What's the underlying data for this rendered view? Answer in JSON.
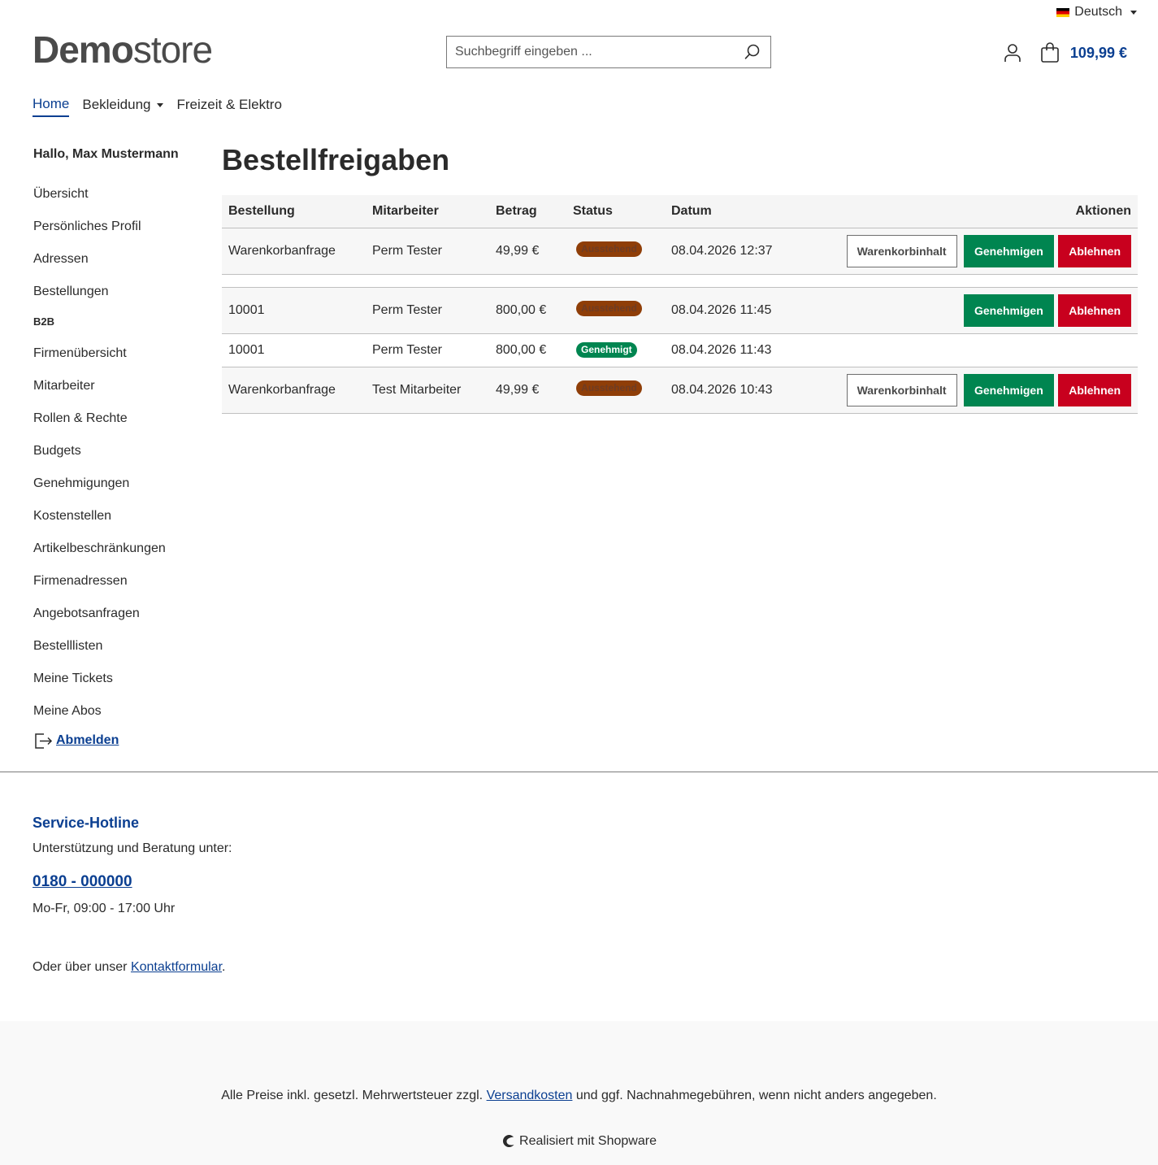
{
  "language": {
    "label": "Deutsch"
  },
  "logo": {
    "bold": "Demo",
    "light": "store"
  },
  "search": {
    "placeholder": "Suchbegriff eingeben ..."
  },
  "cart": {
    "total": "109,99 €"
  },
  "nav": {
    "items": [
      {
        "label": "Home"
      },
      {
        "label": "Bekleidung"
      },
      {
        "label": "Freizeit & Elektro"
      }
    ]
  },
  "sidebar": {
    "greeting": "Hallo, Max Mustermann",
    "links": [
      "Übersicht",
      "Persönliches Profil",
      "Adressen",
      "Bestellungen"
    ],
    "section_b2b": "B2B",
    "b2b_links": [
      "Firmenübersicht",
      "Mitarbeiter",
      "Rollen & Rechte",
      "Budgets",
      "Genehmigungen",
      "Kostenstellen",
      "Artikelbeschränkungen",
      "Firmenadressen",
      "Angebotsanfragen",
      "Bestelllisten",
      "Meine Tickets",
      "Meine Abos"
    ],
    "logout": "Abmelden"
  },
  "main": {
    "title": "Bestellfreigaben",
    "columns": [
      "Bestellung",
      "Mitarbeiter",
      "Betrag",
      "Status",
      "Datum",
      "Aktionen"
    ],
    "rows": [
      {
        "order": "Warenkorbanfrage",
        "employee": "Perm Tester",
        "amount": "49,99 €",
        "status": "Ausstehend",
        "date": "08.04.2026 12:37"
      },
      {
        "order": "10001",
        "employee": "Perm Tester",
        "amount": "800,00 €",
        "status": "Ausstehend",
        "date": "08.04.2026 11:45"
      },
      {
        "order": "10001",
        "employee": "Perm Tester",
        "amount": "800,00 €",
        "status": "Genehmigt",
        "date": "08.04.2026 11:43"
      },
      {
        "order": "Warenkorbanfrage",
        "employee": "Test Mitarbeiter",
        "amount": "49,99 €",
        "status": "Ausstehend",
        "date": "08.04.2026 10:43"
      }
    ],
    "actions": {
      "cart": "Warenkorbinhalt",
      "approve": "Genehmigen",
      "decline": "Ablehnen"
    }
  },
  "footer": {
    "hotline_title": "Service-Hotline",
    "support_text": "Unterstützung und Beratung unter:",
    "phone": "0180 - 000000",
    "hours": "Mo-Fr, 09:00 - 17:00 Uhr",
    "contact_prefix": "Oder über unser ",
    "contact_link": "Kontaktformular",
    "contact_suffix": ".",
    "vat_prefix": "Alle Preise inkl. gesetzl. Mehrwertsteuer zzgl. ",
    "vat_link": "Versandkosten",
    "vat_suffix": " und ggf. Nachnahmegebühren, wenn nicht anders angegeben.",
    "powered": "Realisiert mit Shopware"
  },
  "colors": {
    "brand": "#0b3f91",
    "approve": "#008550",
    "decline": "#c8001e",
    "pending": "#8f3e08"
  }
}
